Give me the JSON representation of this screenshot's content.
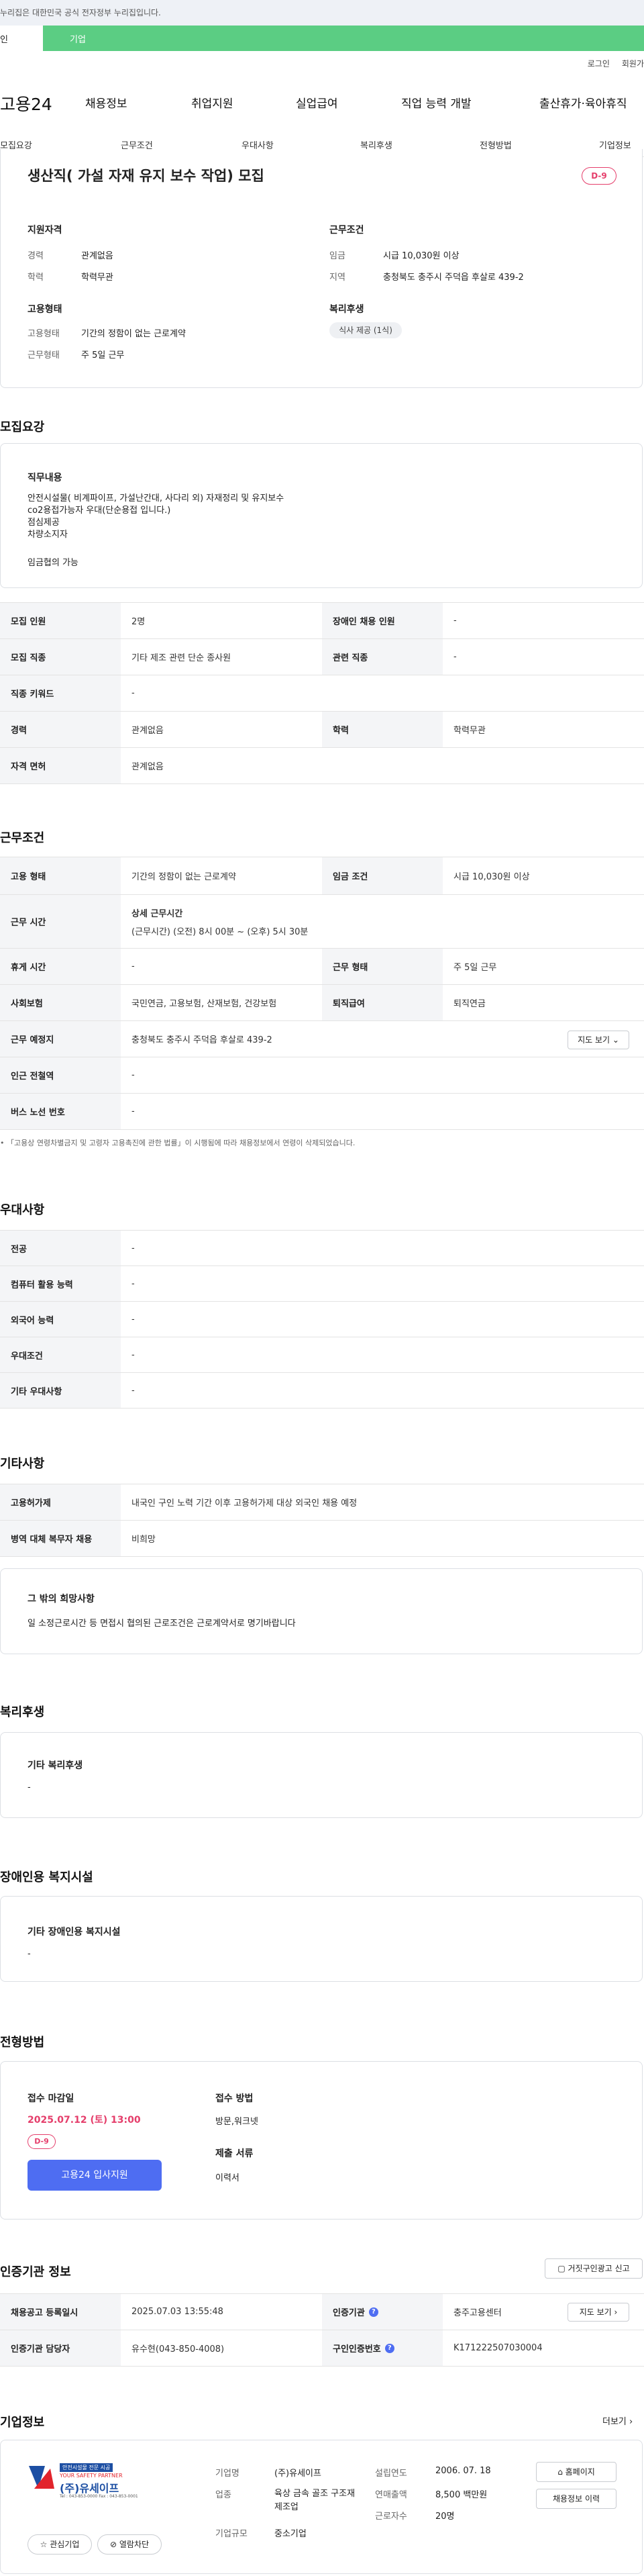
{
  "top_notice": "누리집은 대한민국 공식 전자정부 누리집입니다.",
  "tabs": [
    "인",
    "기업"
  ],
  "utils": [
    "로그인",
    "회원가"
  ],
  "gnb": {
    "logo": "고용24",
    "items": [
      "채용정보",
      "취업지원",
      "실업급여",
      "직업 능력 개발",
      "출산휴가·육아휴직"
    ]
  },
  "subnav": [
    "모집요강",
    "근무조건",
    "우대사항",
    "복리후생",
    "전형방법",
    "기업정보"
  ],
  "job": {
    "title": "생산직( 가설 자재 유지 보수 작업) 모집",
    "dday": "D-9",
    "qual_title": "지원자격",
    "qual": [
      [
        "경력",
        "관계없음"
      ],
      [
        "학력",
        "학력무관"
      ]
    ],
    "cond_title": "근무조건",
    "cond": [
      [
        "임금",
        "시급 10,030원 이상"
      ],
      [
        "지역",
        "충청북도 충주시 주덕읍 후살로 439-2"
      ]
    ],
    "emp_title": "고용형태",
    "emp": [
      [
        "고용형태",
        "기간의 정함이 없는 근로계약"
      ],
      [
        "근무형태",
        "주 5일 근무"
      ]
    ],
    "welfare_title": "복리후생",
    "welfare_chip": "식사 제공 (1식)"
  },
  "recruit": {
    "title": "모집요강",
    "duty_title": "직무내용",
    "duty_lines": [
      "안전시설물( 비계파이프, 가설난간대, 사다리 외) 자재정리 및 유지보수",
      "co2용접가능자 우대(단순용접 입니다.)",
      "점심제공",
      "차량소지자",
      "",
      "임금협의 가능"
    ],
    "table": [
      [
        "모집 인원",
        "2명",
        "장애인 채용 인원",
        "-"
      ],
      [
        "모집 직종",
        "기타 제조 관련 단순 종사원",
        "관련 직종",
        "-"
      ],
      [
        "직종 키워드",
        "-"
      ],
      [
        "경력",
        "관계없음",
        "학력",
        "학력무관"
      ],
      [
        "자격 면허",
        "관계없음"
      ]
    ]
  },
  "work": {
    "title": "근무조건",
    "r1": [
      "고용 형태",
      "기간의 정함이 없는 근로계약",
      "임금 조건",
      "시급 10,030원 이상"
    ],
    "r2": [
      "근무 시간",
      "상세 근무시간",
      "(근무시간) (오전) 8시 00분 ~ (오후) 5시 30분"
    ],
    "r3": [
      "휴게 시간",
      "-",
      "근무 형태",
      "주 5일 근무"
    ],
    "r4": [
      "사회보험",
      "국민연금, 고용보험, 산재보험, 건강보험",
      "퇴직급여",
      "퇴직연금"
    ],
    "r5": [
      "근무 예정지",
      "충청북도 충주시 주덕읍 후살로 439-2",
      "지도 보기"
    ],
    "r6": [
      "인근 전철역",
      "-"
    ],
    "r7": [
      "버스 노선 번호",
      "-"
    ],
    "note": "「고용상 연령차별금지 및 고령자 고용촉진에 관한 법률」이 시행됨에 따라 채용정보에서 연령이 삭제되었습니다."
  },
  "pref": {
    "title": "우대사항",
    "rows": [
      [
        "전공",
        "-"
      ],
      [
        "컴퓨터 활용 능력",
        "-"
      ],
      [
        "외국어 능력",
        "-"
      ],
      [
        "우대조건",
        "-"
      ],
      [
        "기타 우대사항",
        "-"
      ]
    ]
  },
  "etc": {
    "title": "기타사항",
    "rows": [
      [
        "고용허가제",
        "내국인 구인 노력 기간 이후 고용허가제 대상 외국인 채용 예정"
      ],
      [
        "병역 대체 복무자 채용",
        "비희망"
      ]
    ],
    "hope_title": "그 밖의 희망사항",
    "hope": "일 소정근로시간 등 면접시 협의된 근로조건은 근로계약서로 명기바랍니다"
  },
  "benefit": {
    "title": "복리후생",
    "sub": "기타 복리후생",
    "val": "-"
  },
  "disabled": {
    "title": "장애인용 복지시설",
    "sub": "기타 장애인용 복지시설",
    "val": "-"
  },
  "process": {
    "title": "전형방법",
    "deadline_title": "접수 마감일",
    "deadline": "2025.07.12 (토) 13:00",
    "dday": "D-9",
    "apply": "고용24 입사지원",
    "method_title": "접수 방법",
    "method": "방문,워크넷",
    "docs_title": "제출 서류",
    "docs": "이력서"
  },
  "cert": {
    "title": "인증기관 정보",
    "report": "거짓구인광고 신고",
    "r1": [
      "채용공고 등록일시",
      "2025.07.03 13:55:48",
      "인증기관",
      "충주고용센터",
      "지도 보기"
    ],
    "r2": [
      "인증기관 담당자",
      "유수현(043-850-4008)",
      "구인인증번호",
      "K171222507030004"
    ]
  },
  "company": {
    "title": "기업정보",
    "more": "더보기",
    "logo_top": "안전시설물 전문 시공",
    "logo_tag": "YOUR SAFETY PARTNER",
    "logo_name": "(주)유세이프",
    "logo_tel": "Tel : 043-853-0000   Fax : 043-853-0001",
    "fav": "관심기업",
    "block": "열람차단",
    "fields": [
      [
        "기업명",
        "(주)유세이프"
      ],
      [
        "업종",
        "육상 금속 골조 구조재 제조업"
      ],
      [
        "기업규모",
        "중소기업"
      ]
    ],
    "fields2": [
      [
        "설립연도",
        "2006. 07. 18"
      ],
      [
        "연매출액",
        "8,500 백만원"
      ],
      [
        "근로자수",
        "20명"
      ]
    ],
    "home": "홈페이지",
    "info": "채용정보 이력"
  }
}
